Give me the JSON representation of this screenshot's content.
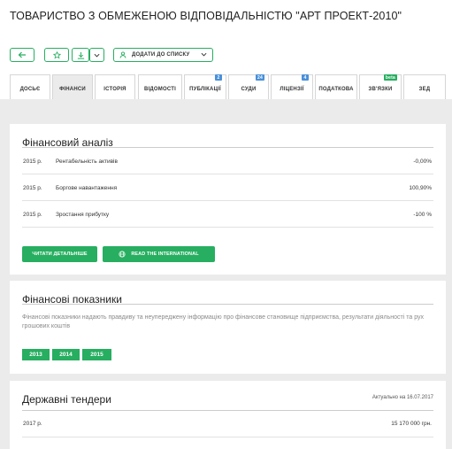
{
  "company": {
    "title": "ТОВАРИСТВО З ОБМЕЖЕНОЮ ВІДПОВІДАЛЬНІСТЮ \"АРТ ПРОЕКТ-2010\""
  },
  "toolbar": {
    "back_icon": "arrow-left-icon",
    "favorite_icon": "star-icon",
    "download_icon": "download-icon",
    "dropdown_icon": "chevron-down-icon",
    "add_to_list_label": "ДОДАТИ ДО СПИСКУ",
    "add_to_list_icon": "user-icon"
  },
  "tabs": [
    {
      "label": "ДОСЬЄ"
    },
    {
      "label": "ФІНАНСИ",
      "active": true
    },
    {
      "label": "ІСТОРІЯ"
    },
    {
      "label": "ВІДОМОСТІ"
    },
    {
      "label": "ПУБЛІКАЦІЇ",
      "badge": "2"
    },
    {
      "label": "СУДИ",
      "badge": "24"
    },
    {
      "label": "ЛІЦЕНЗІЇ",
      "badge": "4"
    },
    {
      "label": "ПОДАТКОВА"
    },
    {
      "label": "ЗВ'ЯЗКИ",
      "badge": "beta"
    },
    {
      "label": "ЗЕД"
    }
  ],
  "financial_analysis": {
    "title": "Фінансовий аналіз",
    "rows": [
      {
        "year": "2015 р.",
        "label": "Рентабельність активів",
        "value": "-0,00%"
      },
      {
        "year": "2015 р.",
        "label": "Боргове навантаження",
        "value": "100,90%"
      },
      {
        "year": "2015 р.",
        "label": "Зростання прибутку",
        "value": "-100 %"
      }
    ],
    "details_button": "ЧИТАТИ ДЕТАЛЬНІШЕ",
    "international_button": "READ THE INTERNATIONAL",
    "globe_icon": "globe-icon"
  },
  "financial_indicators": {
    "title": "Фінансові показники",
    "description": "Фінансові показники надають правдиву та неупереджену інформацію про фінансове становище підприємства, результати діяльності та рух грошових коштів",
    "years": [
      "2013",
      "2014",
      "2015"
    ]
  },
  "tenders": {
    "title": "Державні тендери",
    "updated": "Актуально на 16.07.2017",
    "rows": [
      {
        "year": "2017 р.",
        "value": "15 170 000 грн."
      }
    ]
  },
  "colors": {
    "accent": "#27ae60",
    "badge_blue": "#4a90d9",
    "background": "#ebebeb"
  }
}
